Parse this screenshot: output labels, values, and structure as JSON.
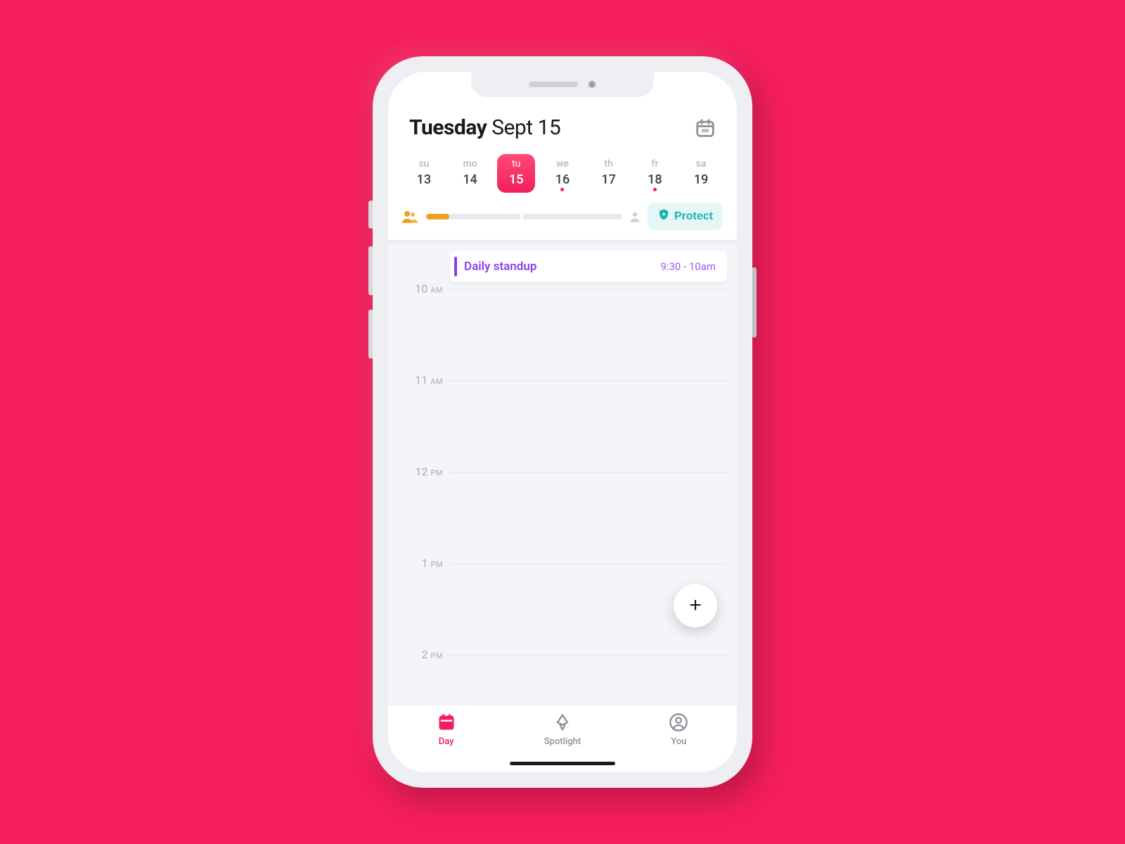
{
  "header": {
    "weekday": "Tuesday",
    "month_day": "Sept 15"
  },
  "week": [
    {
      "dow": "su",
      "num": "13",
      "selected": false,
      "dot": false
    },
    {
      "dow": "mo",
      "num": "14",
      "selected": false,
      "dot": false
    },
    {
      "dow": "tu",
      "num": "15",
      "selected": true,
      "dot": false
    },
    {
      "dow": "we",
      "num": "16",
      "selected": false,
      "dot": true
    },
    {
      "dow": "th",
      "num": "17",
      "selected": false,
      "dot": false
    },
    {
      "dow": "fr",
      "num": "18",
      "selected": false,
      "dot": true
    },
    {
      "dow": "sa",
      "num": "19",
      "selected": false,
      "dot": false
    }
  ],
  "protect_label": "Protect",
  "heat_fill_percent": 12,
  "event": {
    "title": "Daily standup",
    "time": "9:30 - 10am",
    "accent": "#8b3ff0"
  },
  "hours": [
    {
      "num": "10",
      "suffix": "AM"
    },
    {
      "num": "11",
      "suffix": "AM"
    },
    {
      "num": "12",
      "suffix": "PM"
    },
    {
      "num": "1",
      "suffix": "PM"
    },
    {
      "num": "2",
      "suffix": "PM"
    }
  ],
  "nav": [
    {
      "label": "Day",
      "active": true
    },
    {
      "label": "Spotlight",
      "active": false
    },
    {
      "label": "You",
      "active": false
    }
  ],
  "fab_label": "+",
  "colors": {
    "brand": "#f31e5b",
    "teal": "#17b3b3",
    "orange": "#f0a020",
    "purple": "#8b3ff0"
  }
}
